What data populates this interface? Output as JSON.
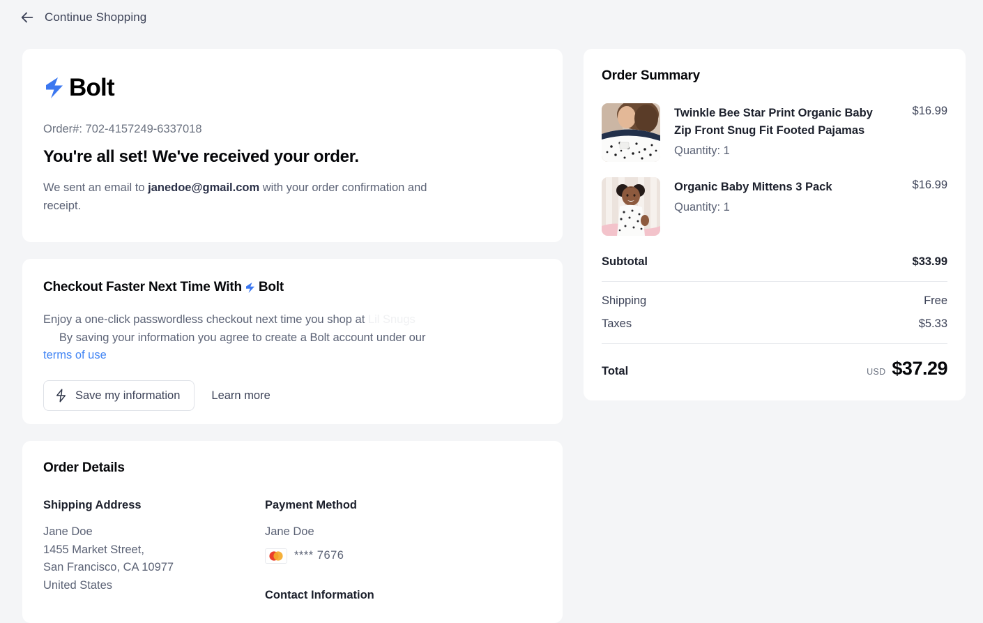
{
  "header": {
    "back_label": "Continue Shopping",
    "back_icon": "arrow-left-icon"
  },
  "brand": {
    "name": "Bolt",
    "mark_icon": "bolt-lightning-icon",
    "accent_color": "#3b77f0"
  },
  "confirmation": {
    "order_number_label": "Order#: 702-4157249-6337018",
    "headline": "You're all set! We've received your order.",
    "body_before": "We sent an email to ",
    "email": "janedoe@gmail.com",
    "body_after": " with your order confirmation and receipt."
  },
  "save_info": {
    "title_before": "Checkout Faster Next Time With ",
    "title_brand": "Bolt",
    "body_line1_before": "Enjoy a one-click passwordless checkout next time you shop at ",
    "merchant_name": "Lil Snugs",
    "body_line2": "By saving your information you agree to create a Bolt account under our",
    "terms_link": "terms of use",
    "save_button_label": "Save my information",
    "save_button_icon": "bolt-lightning-icon",
    "learn_more_label": "Learn more"
  },
  "order_details": {
    "title": "Order Details",
    "shipping": {
      "title": "Shipping Address",
      "lines": [
        "Jane Doe",
        "1455 Market Street,",
        "San Francisco, CA 10977",
        "United States"
      ]
    },
    "payment": {
      "title": "Payment Method",
      "name": "Jane Doe",
      "card_brand_icon": "mastercard-icon",
      "card_digits": "**** 7676"
    },
    "contact": {
      "title": "Contact Information"
    }
  },
  "order_summary": {
    "title": "Order Summary",
    "items": [
      {
        "name": "Twinkle Bee Star Print Organic Baby Zip Front Snug Fit Footed Pajamas",
        "quantity_label": "Quantity: 1",
        "price": "$16.99",
        "image_alt": "baby-pajamas-thumbnail"
      },
      {
        "name": "Organic Baby Mittens 3 Pack",
        "quantity_label": "Quantity: 1",
        "price": "$16.99",
        "image_alt": "baby-mittens-thumbnail"
      }
    ],
    "subtotal": {
      "label": "Subtotal",
      "value": "$33.99"
    },
    "shipping": {
      "label": "Shipping",
      "value": "Free"
    },
    "taxes": {
      "label": "Taxes",
      "value": "$5.33"
    },
    "total": {
      "label": "Total",
      "currency": "USD",
      "value": "$37.29"
    }
  }
}
